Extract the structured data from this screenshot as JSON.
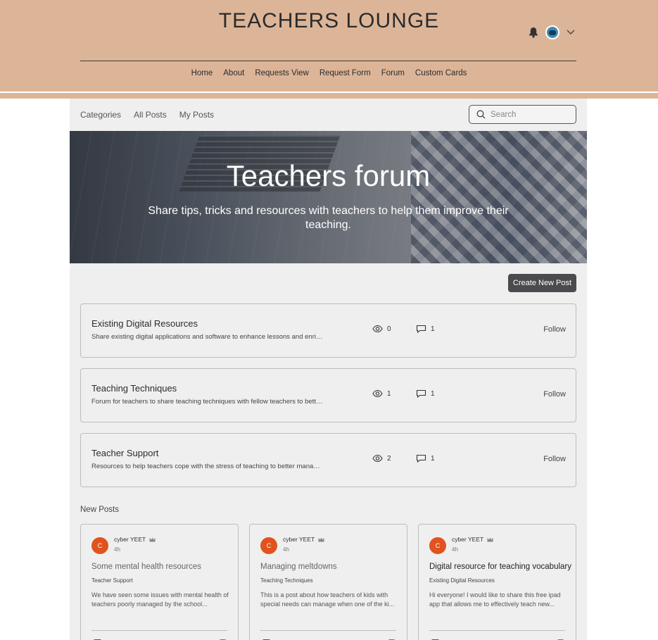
{
  "header": {
    "site_title": "TEACHERS LOUNGE",
    "nav": [
      "Home",
      "About",
      "Requests View",
      "Request Form",
      "Forum",
      "Custom Cards"
    ]
  },
  "forum": {
    "tabs": [
      "Categories",
      "All Posts",
      "My Posts"
    ],
    "search": {
      "placeholder": "Search"
    },
    "hero": {
      "title": "Teachers forum",
      "subtitle": "Share tips, tricks and resources with teachers to help them improve their teaching."
    },
    "create_post_label": "Create New Post",
    "categories": [
      {
        "title": "Existing Digital Resources",
        "description": "Share existing digital applications and software to enhance lessons and enrich st...",
        "views": "0",
        "comments": "1",
        "follow": "Follow"
      },
      {
        "title": "Teaching Techniques",
        "description": "Forum for teachers to share teaching techniques with fellow teachers to better ...",
        "views": "1",
        "comments": "1",
        "follow": "Follow"
      },
      {
        "title": "Teacher Support",
        "description": "Resources to help teachers cope with the stress of teaching to better manage t...",
        "views": "2",
        "comments": "1",
        "follow": "Follow"
      }
    ],
    "new_posts_label": "New Posts",
    "posts": [
      {
        "avatar_letter": "C",
        "author": "cyber YEET",
        "time": "4h",
        "title": "Some mental health resources",
        "category": "Teacher Support",
        "excerpt": "We have seen some issues with mental health of teachers poorly managed by the school..."
      },
      {
        "avatar_letter": "C",
        "author": "cyber YEET",
        "time": "4h",
        "title": "Managing meltdowns",
        "category": "Teaching Techniques",
        "excerpt": "This is a post about how teachers of kids with special needs can manage when one of the ki..."
      },
      {
        "avatar_letter": "C",
        "author": "cyber YEET",
        "time": "4h",
        "title": "Digital resource for teaching vocabulary",
        "category": "Existing Digital Resources",
        "excerpt": "Hi everyone! I would like to share this free ipad app that allows me to effectively teach new..."
      }
    ]
  },
  "colors": {
    "header_bg": "#dcb598",
    "accent": "#e0531f",
    "button_bg": "#4a4a4f",
    "forum_bg": "#efefef"
  }
}
